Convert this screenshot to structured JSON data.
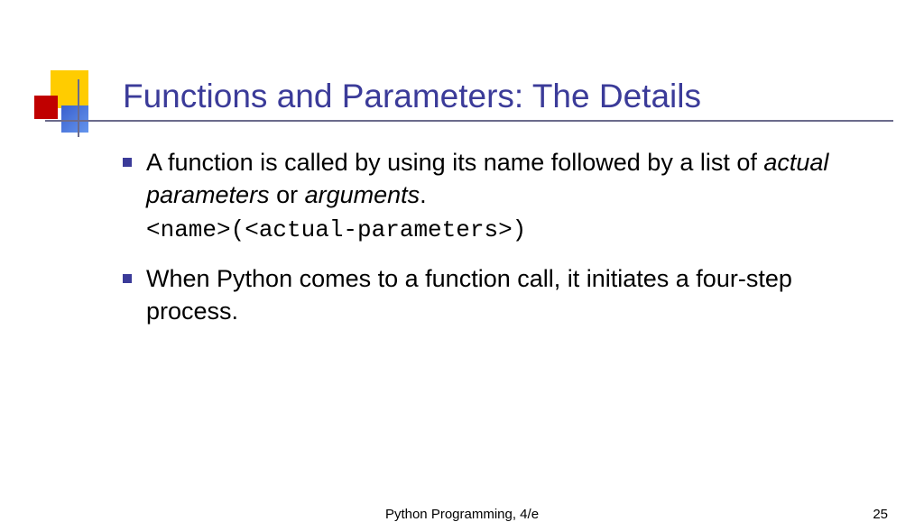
{
  "title": "Functions and Parameters: The Details",
  "bullets": [
    {
      "prefix": "A function is called by using its name followed by a list of ",
      "italic1": "actual parameters",
      "mid": " or ",
      "italic2": "arguments",
      "suffix": ".",
      "code": "<name>(<actual-parameters>)"
    },
    {
      "text": "When Python comes to a function call, it initiates a four-step process."
    }
  ],
  "footer": {
    "center": "Python Programming, 4/e",
    "right": "25"
  }
}
